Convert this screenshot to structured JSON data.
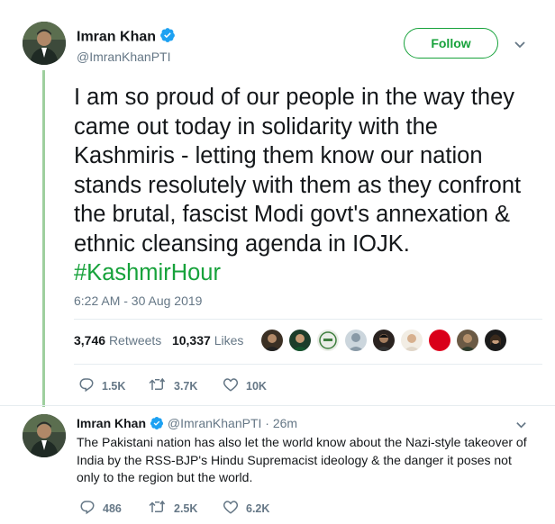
{
  "tweet": {
    "author_name": "Imran Khan",
    "author_handle": "@ImranKhanPTI",
    "follow_label": "Follow",
    "text": "I am so proud of our people in the way they came out today in solidarity with the Kashmiris - letting them know our nation stands resolutely with them as they confront the brutal, fascist Modi govt's annexation & ethnic cleansing agenda in IOJK. ",
    "hashtag": "#KashmirHour",
    "timestamp": "6:22 AM - 30 Aug 2019",
    "retweets_count": "3,746",
    "retweets_label": "Retweets",
    "likes_count": "10,337",
    "likes_label": "Likes",
    "actions": {
      "replies": "1.5K",
      "retweets": "3.7K",
      "likes": "10K"
    }
  },
  "reply": {
    "author_name": "Imran Khan",
    "author_handle": "@ImranKhanPTI",
    "separator": "·",
    "time": "26m",
    "text": "The Pakistani nation has also let the world know about the Nazi-style takeover of India by the RSS-BJP's Hindu Supremacist ideology & the danger it poses not only to the region but the world.",
    "actions": {
      "replies": "486",
      "retweets": "2.5K",
      "likes": "6.2K"
    }
  },
  "colors": {
    "accent": "#17a23b",
    "verified": "#1da1f2",
    "muted": "#657786",
    "thread_line": "#9ecf9e"
  },
  "icons": [
    "verified-badge-icon",
    "chevron-down-icon",
    "reply-icon",
    "retweet-icon",
    "heart-icon"
  ]
}
